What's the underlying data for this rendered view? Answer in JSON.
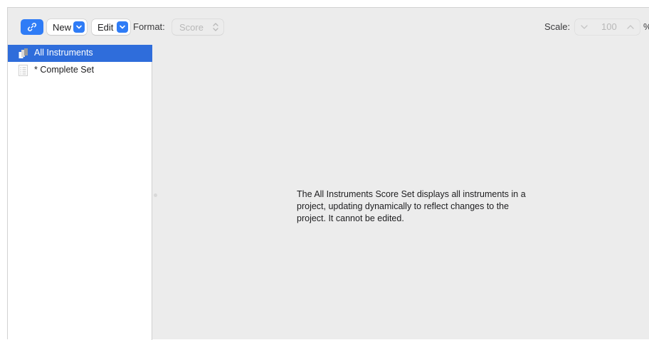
{
  "toolbar": {
    "link_icon": "link-icon",
    "new_label": "New",
    "edit_label": "Edit",
    "format_label": "Format:",
    "format_value": "Score",
    "scale_label": "Scale:",
    "scale_value": "100",
    "percent_label": "%",
    "accent_color": "#2f7cf6"
  },
  "sidebar": {
    "items": [
      {
        "label": "All Instruments",
        "icon": "instruments-icon",
        "selected": true
      },
      {
        "label": "* Complete Set",
        "icon": "list-icon",
        "selected": false
      }
    ],
    "selection_color": "#2f6ddb"
  },
  "content": {
    "message": "The All Instruments Score Set displays all instruments in a project, updating dynamically to reflect changes to the project. It cannot be edited."
  }
}
